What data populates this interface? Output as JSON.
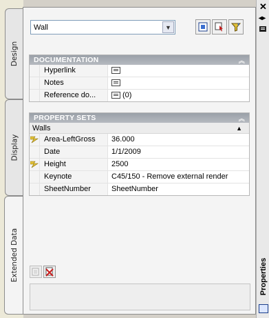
{
  "left_tabs": [
    {
      "label": "Design"
    },
    {
      "label": "Display"
    },
    {
      "label": "Extended Data"
    }
  ],
  "right_bar": {
    "title": "Properties"
  },
  "selector": {
    "value": "Wall"
  },
  "sections": {
    "documentation": {
      "title": "DOCUMENTATION",
      "rows": [
        {
          "label": "Hyperlink",
          "value": ""
        },
        {
          "label": "Notes",
          "value": ""
        },
        {
          "label": "Reference do...",
          "value": "(0)"
        }
      ]
    },
    "property_sets": {
      "title": "PROPERTY SETS",
      "subgroup": "Walls",
      "rows": [
        {
          "label": "Area-LeftGross",
          "value": "36.000",
          "icon": "lightning-icon"
        },
        {
          "label": "Date",
          "value": "1/1/2009"
        },
        {
          "label": "Height",
          "value": "2500",
          "icon": "lightning-icon"
        },
        {
          "label": "Keynote",
          "value": "C45/150 - Remove external render"
        },
        {
          "label": "SheetNumber",
          "value": "SheetNumber"
        }
      ]
    }
  },
  "colors": {
    "accent": "#1c3f8c",
    "header": "#9aa0a8",
    "lightning": "#e2c23a"
  }
}
